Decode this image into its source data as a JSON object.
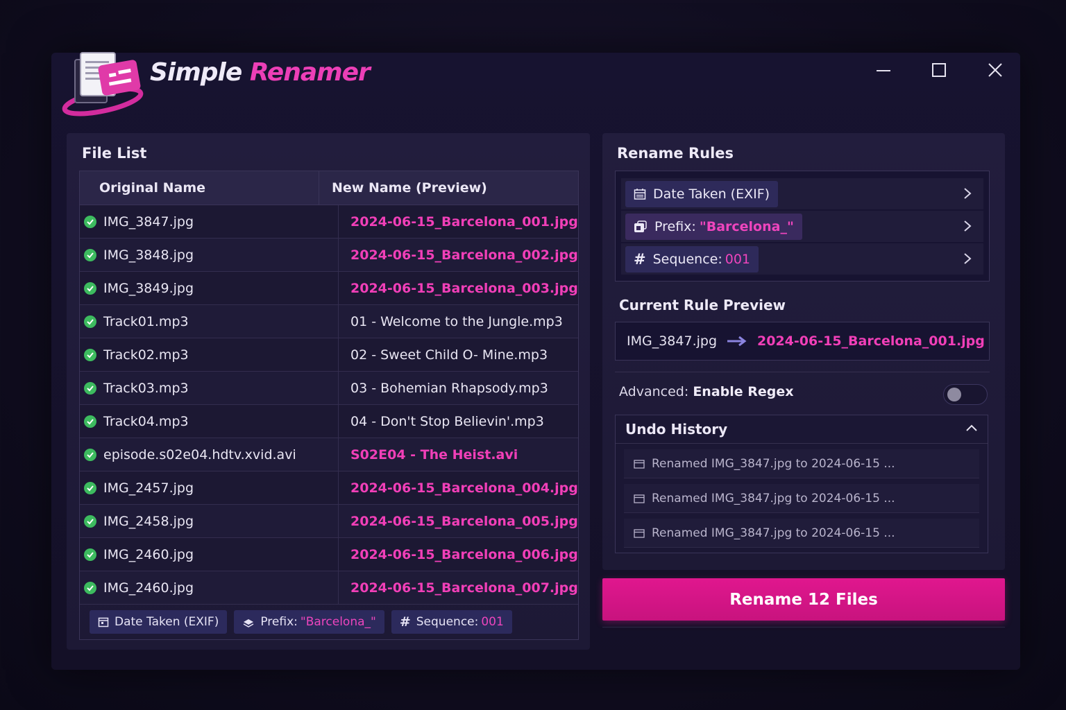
{
  "app": {
    "title_part1": "Simple",
    "title_part2": "Renamer"
  },
  "file_list": {
    "title": "File List",
    "columns": [
      "Original Name",
      "New Name (Preview)"
    ],
    "rows": [
      {
        "original": "IMG_3847.jpg",
        "new": "2024-06-15_Barcelona_001.jpg",
        "highlight": true
      },
      {
        "original": "IMG_3848.jpg",
        "new": "2024-06-15_Barcelona_002.jpg",
        "highlight": true
      },
      {
        "original": "IMG_3849.jpg",
        "new": "2024-06-15_Barcelona_003.jpg",
        "highlight": true
      },
      {
        "original": "Track01.mp3",
        "new": "01 - Welcome to the Jungle.mp3",
        "highlight": false
      },
      {
        "original": "Track02.mp3",
        "new": "02 - Sweet Child O- Mine.mp3",
        "highlight": false
      },
      {
        "original": "Track03.mp3",
        "new": "03 - Bohemian Rhapsody.mp3",
        "highlight": false
      },
      {
        "original": "Track04.mp3",
        "new": "04 - Don't Stop Believin'.mp3",
        "highlight": false
      },
      {
        "original": "episode.s02e04.hdtv.xvid.avi",
        "new": "S02E04 - The Heist.avi",
        "highlight": true
      },
      {
        "original": "IMG_2457.jpg",
        "new": "2024-06-15_Barcelona_004.jpg",
        "highlight": true
      },
      {
        "original": "IMG_2458.jpg",
        "new": "2024-06-15_Barcelona_005.jpg",
        "highlight": true
      },
      {
        "original": "IMG_2460.jpg",
        "new": "2024-06-15_Barcelona_006.jpg",
        "highlight": true
      },
      {
        "original": "IMG_2460.jpg",
        "new": "2024-06-15_Barcelona_007.jpg",
        "highlight": true
      }
    ],
    "chips": {
      "date": "Date Taken (EXIF)",
      "prefix_label": "Prefix:",
      "prefix_value": "\"Barcelona_\"",
      "sequence_label": "Sequence:",
      "sequence_value": "001"
    }
  },
  "rules": {
    "title": "Rename Rules",
    "date": "Date Taken (EXIF)",
    "prefix_label": "Prefix:",
    "prefix_value": "\"Barcelona_\"",
    "sequence_label": "Sequence:",
    "sequence_value": "001"
  },
  "preview": {
    "title": "Current Rule Preview",
    "from": "IMG_3847.jpg",
    "to": "2024-06-15_Barcelona_001.jpg"
  },
  "advanced": {
    "label": "Advanced:",
    "value": "Enable Regex",
    "enabled": false
  },
  "undo": {
    "title": "Undo History",
    "items": [
      "Renamed IMG_3847.jpg to 2024-06-15 ...",
      "Renamed IMG_3847.jpg to 2024-06-15 ...",
      "Renamed IMG_3847.jpg to 2024-06-15 ..."
    ]
  },
  "actions": {
    "rename_label": "Rename 12 Files"
  },
  "colors": {
    "accent": "#e0178e",
    "highlight_text": "#f13fb8",
    "success": "#3dbb5f"
  }
}
